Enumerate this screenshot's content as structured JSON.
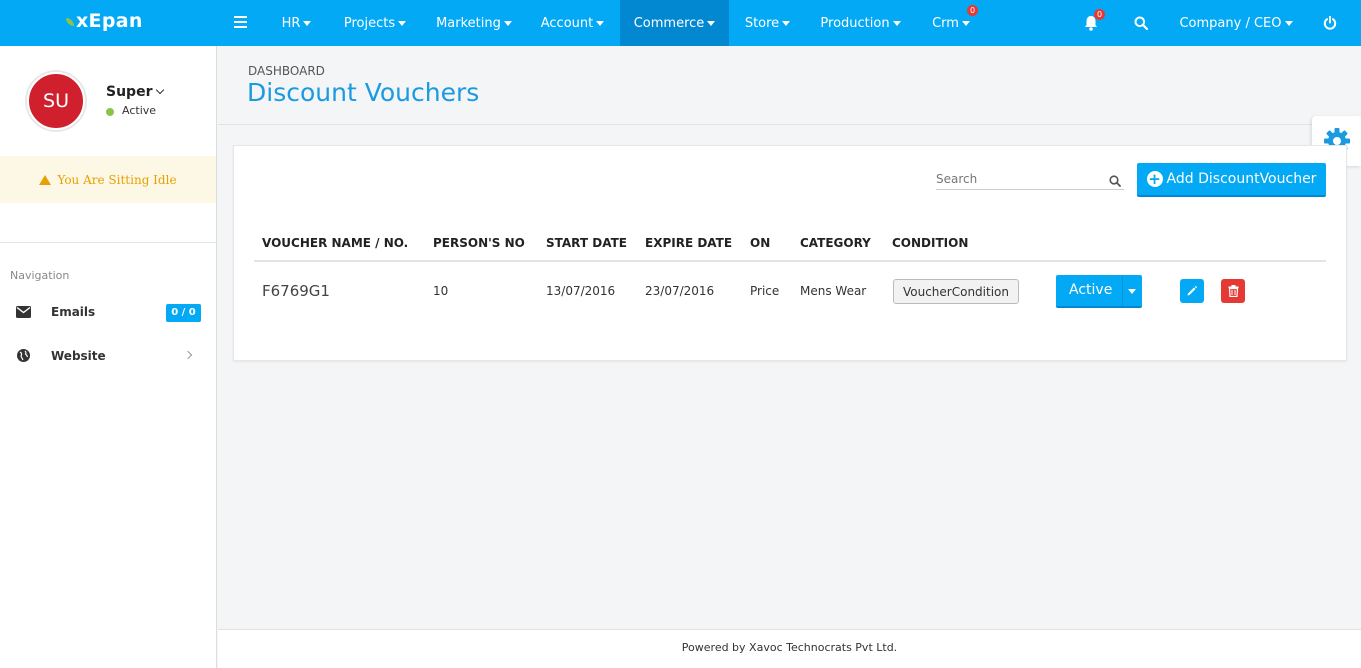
{
  "app": {
    "logo_text": "xEpan"
  },
  "topnav": {
    "items": [
      {
        "label": "HR"
      },
      {
        "label": "Projects"
      },
      {
        "label": "Marketing"
      },
      {
        "label": "Account"
      },
      {
        "label": "Commerce"
      },
      {
        "label": "Store"
      },
      {
        "label": "Production"
      },
      {
        "label": "Crm",
        "badge": "0"
      }
    ],
    "active": "Commerce",
    "notification_badge": "0",
    "user_menu": "Company / CEO"
  },
  "sidebar": {
    "avatar_initials": "SU",
    "user_name": "Super",
    "user_status": "Active",
    "idle_message": "You Are Sitting Idle",
    "nav_heading": "Navigation",
    "items": [
      {
        "label": "Emails",
        "badge": "0 / 0",
        "icon": "envelope-icon"
      },
      {
        "label": "Website",
        "icon": "globe-icon"
      }
    ]
  },
  "page": {
    "breadcrumb": "DASHBOARD",
    "title": "Discount Vouchers"
  },
  "toolbar": {
    "search_placeholder": "Search",
    "add_button_label": "Add DiscountVoucher"
  },
  "table": {
    "columns": [
      "VOUCHER NAME / NO.",
      "PERSON'S NO",
      "START DATE",
      "EXPIRE DATE",
      "ON",
      "CATEGORY",
      "CONDITION"
    ],
    "rows": [
      {
        "voucher": "F6769G1",
        "persons": "10",
        "start_date": "13/07/2016",
        "expire_date": "23/07/2016",
        "on": "Price",
        "category": "Mens Wear",
        "condition_button": "VoucherCondition",
        "status_button": "Active"
      }
    ]
  },
  "footer": {
    "text": "Powered by Xavoc Technocrats Pvt Ltd."
  },
  "colors": {
    "primary": "#03a9f4",
    "primary_dark": "#0288d1",
    "danger": "#e53935",
    "avatar": "#d0202e",
    "idle_text": "#e6a100",
    "title": "#1a9ae0"
  }
}
